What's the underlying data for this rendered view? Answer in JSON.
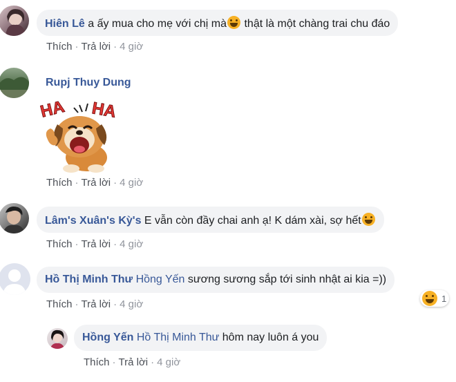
{
  "comments": [
    {
      "author": "Hiên Lê",
      "text_before_emoji": " a ấy mua cho mẹ với chị mà",
      "emoji": "laughing-tears-emoji",
      "text_after_emoji": " thật là một chàng trai chu đáo",
      "actions": {
        "like": "Thích",
        "reply": "Trả lời",
        "time": "4 giờ"
      }
    },
    {
      "author": "Rupj Thuy Dung",
      "sticker": "dog-ha-ha-sticker",
      "sticker_text": [
        "HA",
        "HA"
      ],
      "actions": {
        "like": "Thích",
        "reply": "Trả lời",
        "time": "4 giờ"
      }
    },
    {
      "author": "Lâm's Xuân's Kỳ's",
      "text_before_emoji": " E vẫn còn đầy chai anh ạ! K dám xài, sợ hết",
      "emoji": "laughing-tears-emoji",
      "actions": {
        "like": "Thích",
        "reply": "Trả lời",
        "time": "4 giờ"
      }
    },
    {
      "author": "Hồ Thị Minh Thư",
      "mention": "Hồng Yến",
      "text": " sương sương sắp tới sinh nhật ai kia =))",
      "reaction": {
        "icon": "haha-reaction-icon",
        "count": "1"
      },
      "actions": {
        "like": "Thích",
        "reply": "Trả lời",
        "time": "4 giờ"
      }
    },
    {
      "author": "Hồng Yến",
      "mention": "Hồ Thị Minh Thư",
      "text": " hôm nay luôn á you",
      "actions": {
        "like": "Thích",
        "reply": "Trả lời",
        "time": "4 giờ"
      }
    }
  ],
  "colors": {
    "name": "#385898",
    "bubble": "#f2f3f5",
    "meta": "#90949c"
  }
}
